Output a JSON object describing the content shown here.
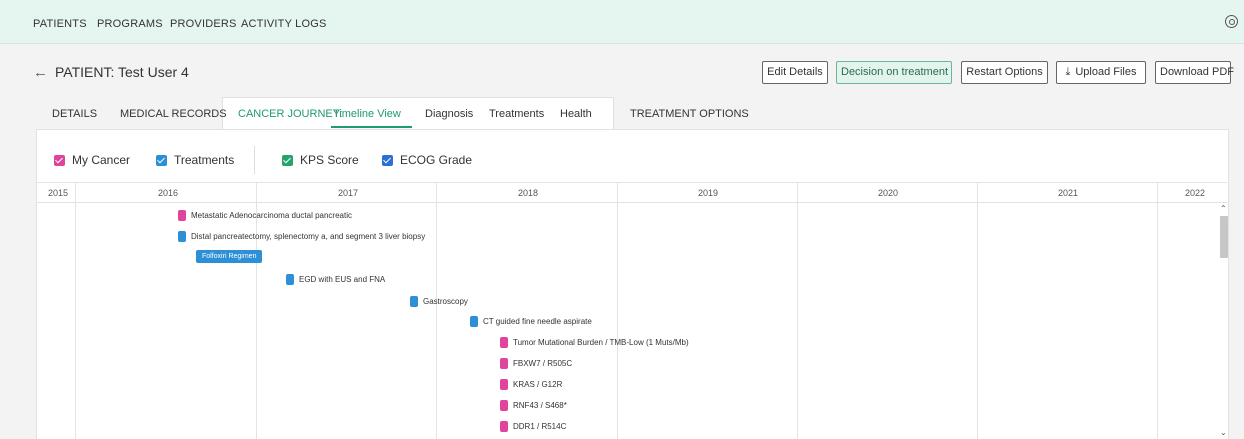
{
  "topnav": {
    "items": [
      "PATIENTS",
      "PROGRAMS",
      "PROVIDERS",
      "ACTIVITY LOGS"
    ],
    "settings_icon": "settings-icon"
  },
  "header": {
    "back_icon": "arrow-left-icon",
    "back_glyph": "←",
    "title": "PATIENT: Test User 4"
  },
  "buttons": {
    "edit_details": "Edit Details",
    "decision": "Decision on treatment",
    "restart": "Restart Options",
    "upload": "Upload Files",
    "upload_icon": "upload-icon",
    "upload_glyph": "⤓",
    "download": "Download PDF"
  },
  "tabs": {
    "details": "DETAILS",
    "medical_records": "MEDICAL RECORDS",
    "cancer_journey": "CANCER JOURNEY:",
    "timeline": "Timeline View",
    "diagnosis": "Diagnosis",
    "treatments": "Treatments",
    "health": "Health",
    "treatment_options": "TREATMENT OPTIONS"
  },
  "legend": {
    "my_cancer": "My Cancer",
    "treatments": "Treatments",
    "kps": "KPS Score",
    "ecog": "ECOG Grade"
  },
  "colors": {
    "accent": "#1e9b6f",
    "cancer": "#e0459b",
    "treatment": "#2d8fd6",
    "kps": "#26a36f",
    "ecog": "#2d6fd6"
  },
  "timeline": {
    "years": [
      "2015",
      "2016",
      "2017",
      "2018",
      "2019",
      "2020",
      "2021",
      "2022"
    ],
    "regimen": "Folfoxiri Regimen",
    "events": [
      {
        "label": "Metastatic Adenocarcinoma ductal pancreatic",
        "category": "cancer"
      },
      {
        "label": "Distal pancreatectomy, splenectomy a, and segment 3 liver biopsy",
        "category": "treatment"
      },
      {
        "label": "EGD with EUS and FNA",
        "category": "treatment"
      },
      {
        "label": "Gastroscopy",
        "category": "treatment"
      },
      {
        "label": "CT guided fine needle aspirate",
        "category": "treatment"
      },
      {
        "label": "Tumor Mutational Burden / TMB-Low (1 Muts/Mb)",
        "category": "cancer"
      },
      {
        "label": "FBXW7 / R505C",
        "category": "cancer"
      },
      {
        "label": "KRAS / G12R",
        "category": "cancer"
      },
      {
        "label": "RNF43 / S468*",
        "category": "cancer"
      },
      {
        "label": "DDR1 / R514C",
        "category": "cancer"
      }
    ]
  },
  "scrollbar": {
    "up_glyph": "⌃",
    "down_glyph": "⌄"
  }
}
